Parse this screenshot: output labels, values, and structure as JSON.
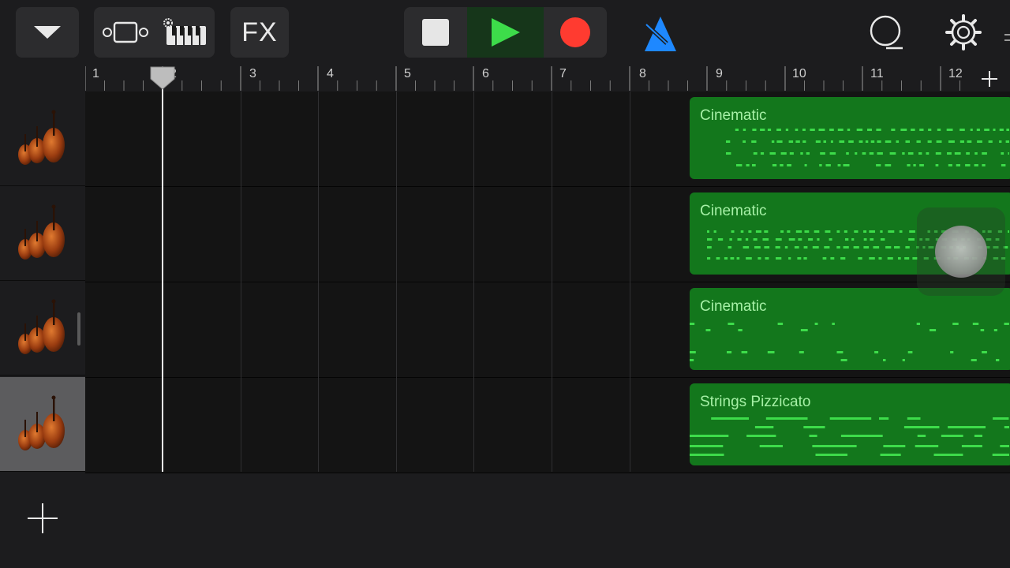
{
  "toolbar": {
    "fx_label": "FX"
  },
  "ruler": {
    "bars": [
      "1",
      "2",
      "3",
      "4",
      "5",
      "6",
      "7",
      "8",
      "9",
      "10",
      "11",
      "12"
    ]
  },
  "tracks": [
    {
      "instrument": "strings",
      "region_name": "Cinematic"
    },
    {
      "instrument": "strings",
      "region_name": "Cinematic"
    },
    {
      "instrument": "strings",
      "region_name": "Cinematic"
    },
    {
      "instrument": "strings",
      "region_name": "Strings Pizzicato"
    }
  ],
  "selected_track": 3,
  "colors": {
    "background": "#1c1c1e",
    "region_fill": "#13771c",
    "region_notes": "#3ddc4a",
    "play": "#3ddc4a",
    "record": "#ff3b30",
    "metronome": "#1e88ff"
  }
}
